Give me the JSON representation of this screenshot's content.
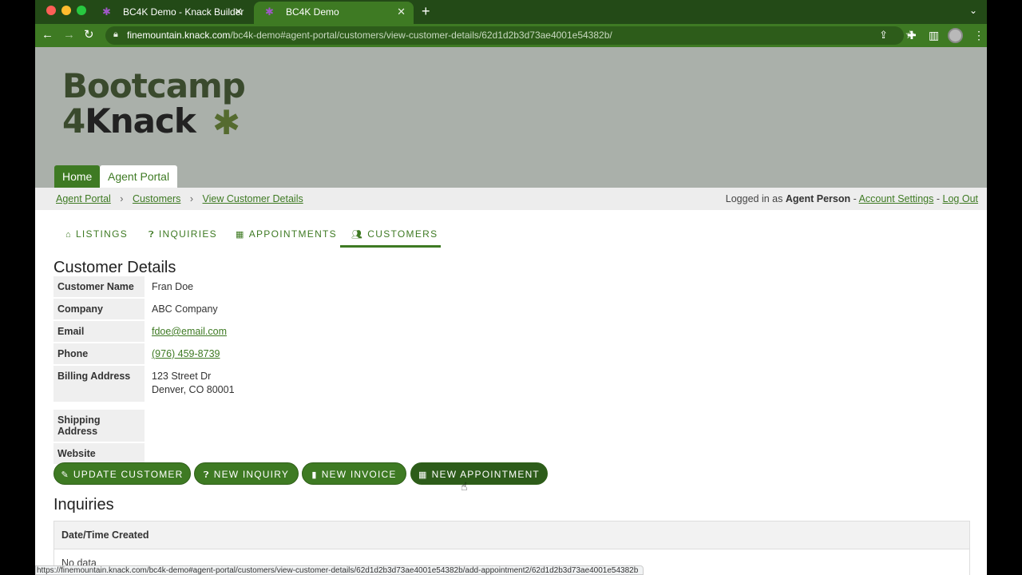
{
  "browser": {
    "tabs": [
      {
        "title": "BC4K Demo - Knack Builder"
      },
      {
        "title": "BC4K Demo"
      }
    ],
    "url_host": "finemountain.knack.com",
    "url_path": "/bc4k-demo#agent-portal/customers/view-customer-details/62d1d2b3d73ae4001e54382b/",
    "status_url": "https://finemountain.knack.com/bc4k-demo#agent-portal/customers/view-customer-details/62d1d2b3d73ae4001e54382b/add-appointment2/62d1d2b3d73ae4001e54382b"
  },
  "header": {
    "logo_line1": "Bootcamp",
    "logo_line2_num": "4",
    "logo_line2": "Knack",
    "menu": [
      "Home",
      "Agent Portal"
    ]
  },
  "breadcrumb": {
    "items": [
      "Agent Portal",
      "Customers",
      "View Customer Details"
    ],
    "separator": "›",
    "logged_in_prefix": "Logged in as",
    "user": "Agent Person",
    "dash": "-",
    "account_settings": "Account Settings",
    "logout": "Log Out"
  },
  "nav": {
    "tabs": [
      "LISTINGS",
      "INQUIRIES",
      "APPOINTMENTS",
      "CUSTOMERS"
    ],
    "active": "CUSTOMERS"
  },
  "details": {
    "title": "Customer Details",
    "fields": {
      "name_label": "Customer Name",
      "name": "Fran Doe",
      "company_label": "Company",
      "company": "ABC Company",
      "email_label": "Email",
      "email": "fdoe@email.com",
      "phone_label": "Phone",
      "phone": "(976) 459-8739",
      "billing_label": "Billing Address",
      "billing_line1": "123 Street Dr",
      "billing_line2": "Denver, CO 80001",
      "shipping_label": "Shipping Address",
      "shipping": "",
      "website_label": "Website",
      "website": ""
    }
  },
  "actions": {
    "update": "UPDATE CUSTOMER",
    "inquiry": "NEW INQUIRY",
    "invoice": "NEW INVOICE",
    "appointment": "NEW APPOINTMENT"
  },
  "inquiries": {
    "title": "Inquiries",
    "column": "Date/Time Created",
    "empty": "No data"
  },
  "colors": {
    "accent": "#3e7a23",
    "header_bg": "#aab0aa",
    "tab_strip": "#234a17"
  }
}
